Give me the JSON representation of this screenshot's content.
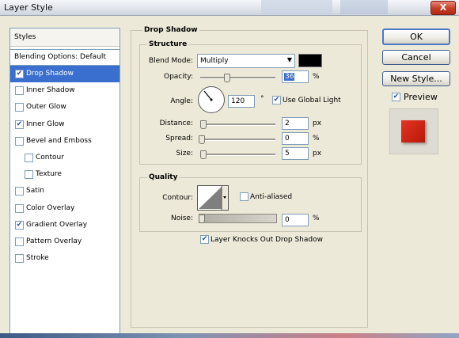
{
  "window": {
    "title": "Layer Style",
    "close_glyph": "X"
  },
  "styles_panel": {
    "header": "Styles",
    "blending_options": "Blending Options: Default",
    "items": [
      {
        "label": "Drop Shadow",
        "checked": true,
        "selected": true
      },
      {
        "label": "Inner Shadow",
        "checked": false
      },
      {
        "label": "Outer Glow",
        "checked": false
      },
      {
        "label": "Inner Glow",
        "checked": true
      },
      {
        "label": "Bevel and Emboss",
        "checked": false
      },
      {
        "label": "Contour",
        "checked": false,
        "sub": true
      },
      {
        "label": "Texture",
        "checked": false,
        "sub": true
      },
      {
        "label": "Satin",
        "checked": false
      },
      {
        "label": "Color Overlay",
        "checked": false
      },
      {
        "label": "Gradient Overlay",
        "checked": true
      },
      {
        "label": "Pattern Overlay",
        "checked": false
      },
      {
        "label": "Stroke",
        "checked": false
      }
    ]
  },
  "drop_shadow": {
    "group_title": "Drop Shadow",
    "structure": {
      "title": "Structure",
      "blend_mode_label": "Blend Mode:",
      "blend_mode_value": "Multiply",
      "shadow_color": "#000000",
      "opacity_label": "Opacity:",
      "opacity_value": "36",
      "opacity_unit": "%",
      "opacity_level": 0.36,
      "angle_label": "Angle:",
      "angle_value": "120",
      "angle_unit": "°",
      "use_global_light_label": "Use Global Light",
      "use_global_light": true,
      "distance_label": "Distance:",
      "distance_value": "2",
      "distance_unit": "px",
      "distance_level": 0.02,
      "spread_label": "Spread:",
      "spread_value": "0",
      "spread_unit": "%",
      "spread_level": 0,
      "size_label": "Size:",
      "size_value": "5",
      "size_unit": "px",
      "size_level": 0.02
    },
    "quality": {
      "title": "Quality",
      "contour_label": "Contour:",
      "anti_aliased_label": "Anti-aliased",
      "anti_aliased": false,
      "noise_label": "Noise:",
      "noise_value": "0",
      "noise_unit": "%",
      "noise_level": 0
    },
    "layer_knocks_out_label": "Layer Knocks Out Drop Shadow",
    "layer_knocks_out": true
  },
  "buttons": {
    "ok": "OK",
    "cancel": "Cancel",
    "new_style": "New Style...",
    "preview_label": "Preview",
    "preview_checked": true
  },
  "colors": {
    "selection": "#3a6fcf",
    "preview_red": "#d42616",
    "check": "#1c4fb0"
  }
}
